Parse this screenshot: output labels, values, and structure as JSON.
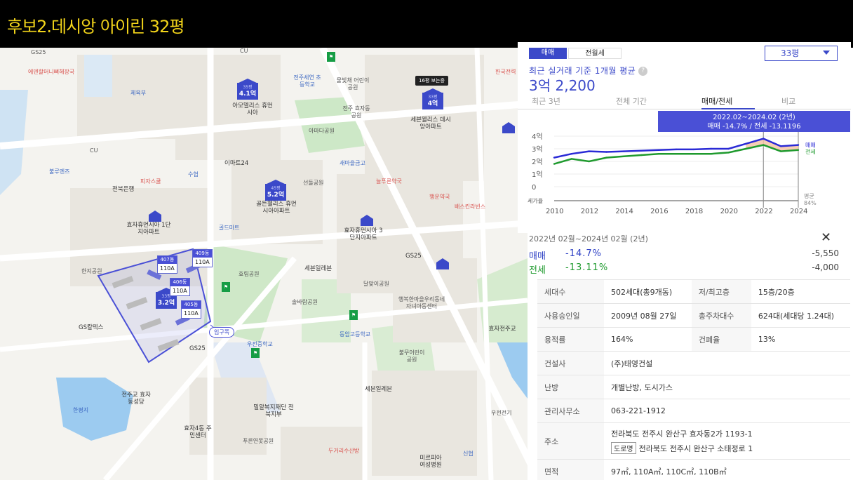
{
  "page_title": "후보2.데시앙 아이린 32평",
  "map": {
    "labels": {
      "gs25_top": "GS25",
      "cu_top": "CU",
      "bridal": "에덴할머니뼈해장국",
      "sports": "체육부",
      "gangnam": "현대찬",
      "cu_left": "CU",
      "bus_left": "불루엔즈",
      "bank": "전북은행",
      "pizza": "피자스쿨",
      "suwon": "수협",
      "emart": "이마트24",
      "elem_school": "전주세연 초등학교",
      "park_top": "물빛채 어린이공원",
      "hyosin": "전주 효자동 공원",
      "park_mid": "아마다공원",
      "saemaeul": "새마을금고",
      "pharm": "늘푸른약국",
      "jeil": "행운약국",
      "pizza2": "배스킨라빈스",
      "seven": "세븐일레븐",
      "building_ubong": "아모델리스 휴먼시아",
      "building_sebien": "세븐웰리스 데시앙아파트",
      "building_hyoja": "효자휴먼시아 1단지아파트",
      "building_5": "골든웰리스 휴먼시아아파트",
      "building_hyoja3": "효자휴먼시아 3단지아파트",
      "park_sun": "선돌공원",
      "golf": "골드마트",
      "yongdam": "효림공원",
      "seven_mid": "세븐일레븐",
      "gs_mid": "GS25",
      "dalmaeul": "달맞이공원",
      "sports_center": "행복한마을우리동네 자녀아동센터",
      "gs_left": "GS칼텍스",
      "gyeonggi": "한지공원",
      "songpa": "솔바람공원",
      "dongam_school": "동암고등학교",
      "woojung": "우전중학교",
      "bulmae": "불무어린이 공원",
      "seven_low": "세븐일레븐",
      "lake": "한평지",
      "hyoja_center": "전주교 효자동성당",
      "hyoja4": "효자4동 주민센터",
      "welfare": "밀알복지재단 전북지부",
      "pure": "푸른연못공원",
      "duguri": "두거리수산방",
      "sinhan": "신협",
      "mirae": "미르피아 여성병원",
      "gs_low": "GS25",
      "jeonju_right": "한국전력",
      "gangnam_right": "우전전기",
      "hyoja_right": "효자전주교"
    },
    "price_markers": [
      {
        "size": "35평",
        "price": "4.1억"
      },
      {
        "size": "33평",
        "price": "4억"
      },
      {
        "size": "45평",
        "price": "5.2억"
      },
      {
        "size": "33평",
        "price": "3.2억"
      }
    ],
    "hover_tip": "16평 보는중",
    "dong_tags": [
      {
        "dong": "407동",
        "type": "110A"
      },
      {
        "dong": "409동",
        "type": "110A"
      },
      {
        "dong": "406동",
        "type": "110A"
      },
      {
        "dong": "405동",
        "type": "110A"
      }
    ],
    "entrance": "입구쪽"
  },
  "panel": {
    "seg_trade": "매매",
    "seg_jeonse": "전월세",
    "pyeong": "33평",
    "avg_label": "최근 실거래 기준 1개월 평균",
    "avg_help": "?",
    "avg_price": "3억 2,200",
    "period_tabs": [
      "최근 3년",
      "전체 기간",
      "매매/전세",
      "비교"
    ],
    "range_badge_line1": "2022.02~2024.02 (2년)",
    "range_badge_line2": "매매 -14.7% / 전세 -13.1196"
  },
  "chart_data": {
    "type": "line",
    "x": [
      2010,
      2011,
      2012,
      2013,
      2014,
      2015,
      2016,
      2017,
      2018,
      2019,
      2020,
      2021,
      2022,
      2023,
      2024
    ],
    "y_ticks": [
      "4억",
      "3억",
      "2억",
      "1억",
      "0"
    ],
    "x_ticks": [
      "2010",
      "2012",
      "2014",
      "2016",
      "2018",
      "2020",
      "2022",
      "2024"
    ],
    "ylim": [
      0,
      4
    ],
    "series": [
      {
        "name": "매매",
        "color": "#2a2ad6",
        "values": [
          2.3,
          2.6,
          2.8,
          2.75,
          2.8,
          2.85,
          2.9,
          2.95,
          2.95,
          3.0,
          3.0,
          3.4,
          3.8,
          3.2,
          3.3
        ]
      },
      {
        "name": "전세",
        "color": "#1f9a2e",
        "values": [
          1.8,
          2.2,
          2.0,
          2.3,
          2.4,
          2.5,
          2.6,
          2.6,
          2.6,
          2.6,
          2.7,
          3.0,
          3.3,
          2.8,
          2.9
        ]
      }
    ],
    "gap_label": "세가율",
    "gap_right": "평균",
    "gap_right_val": "84%",
    "legend_trade": "매매",
    "legend_jeonse": "전세"
  },
  "compare": {
    "range": "2022년 02월~2024년 02월 (2년)",
    "close": "✕",
    "trade_label": "매매",
    "trade_pct": "-14.7%",
    "trade_abs": "-5,550",
    "jeonse_label": "전세",
    "jeonse_pct": "-13.11%",
    "jeonse_abs": "-4,000"
  },
  "info": {
    "households_k": "세대수",
    "households_v": "502세대(총9개동)",
    "floors_k": "저/최고층",
    "floors_v": "15층/20층",
    "approval_k": "사용승인일",
    "approval_v": "2009년 08월 27일",
    "parking_k": "총주차대수",
    "parking_v": "624대(세대당 1.24대)",
    "far_k": "용적률",
    "far_v": "164%",
    "bcr_k": "건폐율",
    "bcr_v": "13%",
    "builder_k": "건설사",
    "builder_v": "(주)태영건설",
    "heating_k": "난방",
    "heating_v": "개별난방, 도시가스",
    "office_k": "관리사무소",
    "office_v": "063-221-1912",
    "addr_k": "주소",
    "addr_v1": "전라북도 전주시 완산구 효자동2가 1193-1",
    "road_badge": "도로명",
    "addr_v2": "전라북도 전주시 완산구 소태정로 1",
    "area_k": "면적",
    "area_v": "97㎡, 110A㎡, 110C㎡, 110B㎡"
  }
}
